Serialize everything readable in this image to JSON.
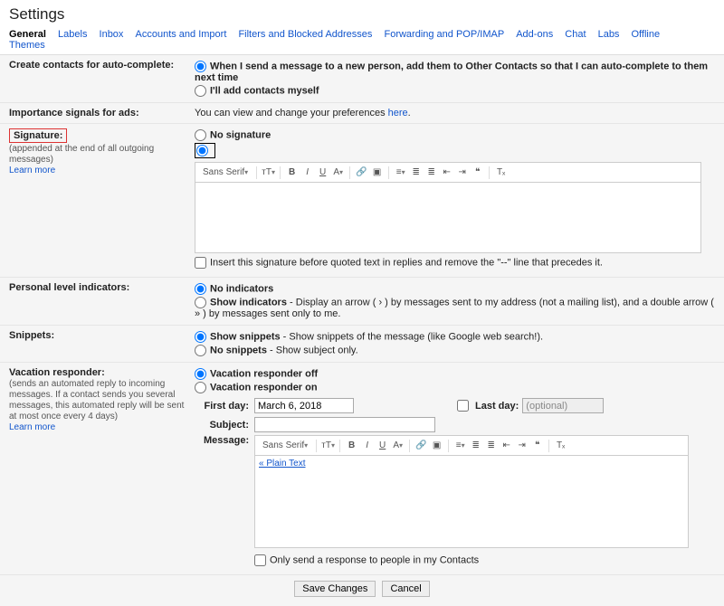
{
  "page_title": "Settings",
  "tabs": [
    "General",
    "Labels",
    "Inbox",
    "Accounts and Import",
    "Filters and Blocked Addresses",
    "Forwarding and POP/IMAP",
    "Add-ons",
    "Chat",
    "Labs",
    "Offline",
    "Themes"
  ],
  "active_tab": "General",
  "autocomplete": {
    "label": "Create contacts for auto-complete:",
    "opt1": "When I send a message to a new person, add them to Other Contacts so that I can auto-complete to them next time",
    "opt2": "I'll add contacts myself"
  },
  "importance": {
    "label": "Importance signals for ads:",
    "text_pre": "You can view and change your preferences ",
    "link": "here",
    "text_post": "."
  },
  "signature": {
    "label": "Signature:",
    "sub": "(appended at the end of all outgoing messages)",
    "learn": "Learn more",
    "opt1": "No signature",
    "font": "Sans Serif",
    "insert_note": "Insert this signature before quoted text in replies and remove the \"--\" line that precedes it."
  },
  "pli": {
    "label": "Personal level indicators:",
    "opt1_b": "No indicators",
    "opt2_b": "Show indicators",
    "opt2_rest": " - Display an arrow ( › ) by messages sent to my address (not a mailing list), and a double arrow ( » ) by messages sent only to me."
  },
  "snippets": {
    "label": "Snippets:",
    "opt1_b": "Show snippets",
    "opt1_rest": " - Show snippets of the message (like Google web search!).",
    "opt2_b": "No snippets",
    "opt2_rest": " - Show subject only."
  },
  "vacation": {
    "label": "Vacation responder:",
    "sub": "(sends an automated reply to incoming messages. If a contact sends you several messages, this automated reply will be sent at most once every 4 days)",
    "learn": "Learn more",
    "off": "Vacation responder off",
    "on": "Vacation responder on",
    "firstday_label": "First day:",
    "firstday_value": "March 6, 2018",
    "lastday_label": "Last day:",
    "lastday_placeholder": "(optional)",
    "subject_label": "Subject:",
    "message_label": "Message:",
    "font": "Sans Serif",
    "plaintext": "« Plain Text",
    "contacts_only": "Only send a response to people in my Contacts"
  },
  "footer": {
    "save": "Save Changes",
    "cancel": "Cancel"
  },
  "tb": {
    "size": "ᴛT",
    "bold": "B",
    "italic": "I",
    "underline": "U",
    "color": "A",
    "link": "🔗",
    "image": "▣",
    "align": "≡",
    "numlist": "≣",
    "bullist": "≣",
    "indentL": "⇤",
    "indentR": "⇥",
    "quote": "❝",
    "clear": "Tₓ"
  }
}
